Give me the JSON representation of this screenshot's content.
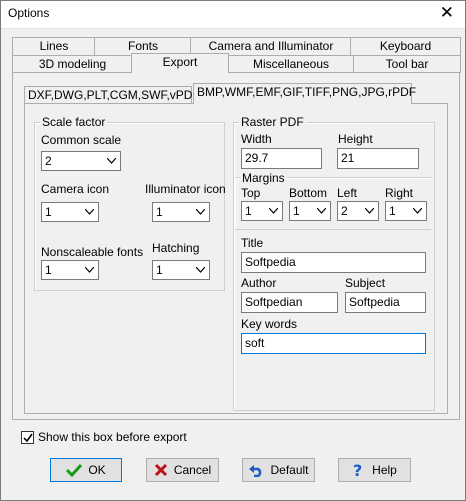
{
  "window": {
    "title": "Options"
  },
  "tabs_row1": [
    "Lines",
    "Fonts",
    "Camera and Illuminator",
    "Keyboard"
  ],
  "tabs_row2": [
    "3D modeling",
    "Export",
    "Miscellaneous",
    "Tool bar"
  ],
  "active_tab": "Export",
  "subtabs": [
    "DXF,DWG,PLT,CGM,SWF,vPDF",
    "BMP,WMF,EMF,GIF,TIFF,PNG,JPG,rPDF"
  ],
  "active_subtab": "BMP,WMF,EMF,GIF,TIFF,PNG,JPG,rPDF",
  "scale": {
    "legend": "Scale factor",
    "common_scale_label": "Common scale",
    "common_scale_value": "2",
    "camera_icon_label": "Camera icon",
    "camera_icon_value": "1",
    "illuminator_icon_label": "Illuminator icon",
    "illuminator_icon_value": "1",
    "nonscaleable_label": "Nonscaleable fonts",
    "nonscaleable_value": "1",
    "hatching_label": "Hatching",
    "hatching_value": "1"
  },
  "raster": {
    "legend": "Raster PDF",
    "width_label": "Width",
    "width_value": "29.7",
    "height_label": "Height",
    "height_value": "21",
    "margins_legend": "Margins",
    "top_label": "Top",
    "top_value": "1",
    "bottom_label": "Bottom",
    "bottom_value": "1",
    "left_label": "Left",
    "left_value": "2",
    "right_label": "Right",
    "right_value": "1",
    "title_label": "Title",
    "title_value": "Softpedia",
    "author_label": "Author",
    "author_value": "Softpedian",
    "subject_label": "Subject",
    "subject_value": "Softpedia",
    "keywords_label": "Key words",
    "keywords_value": "soft"
  },
  "show_box": {
    "label": "Show this box before export",
    "checked": true
  },
  "buttons": {
    "ok": "OK",
    "cancel": "Cancel",
    "default": "Default",
    "help": "Help"
  }
}
